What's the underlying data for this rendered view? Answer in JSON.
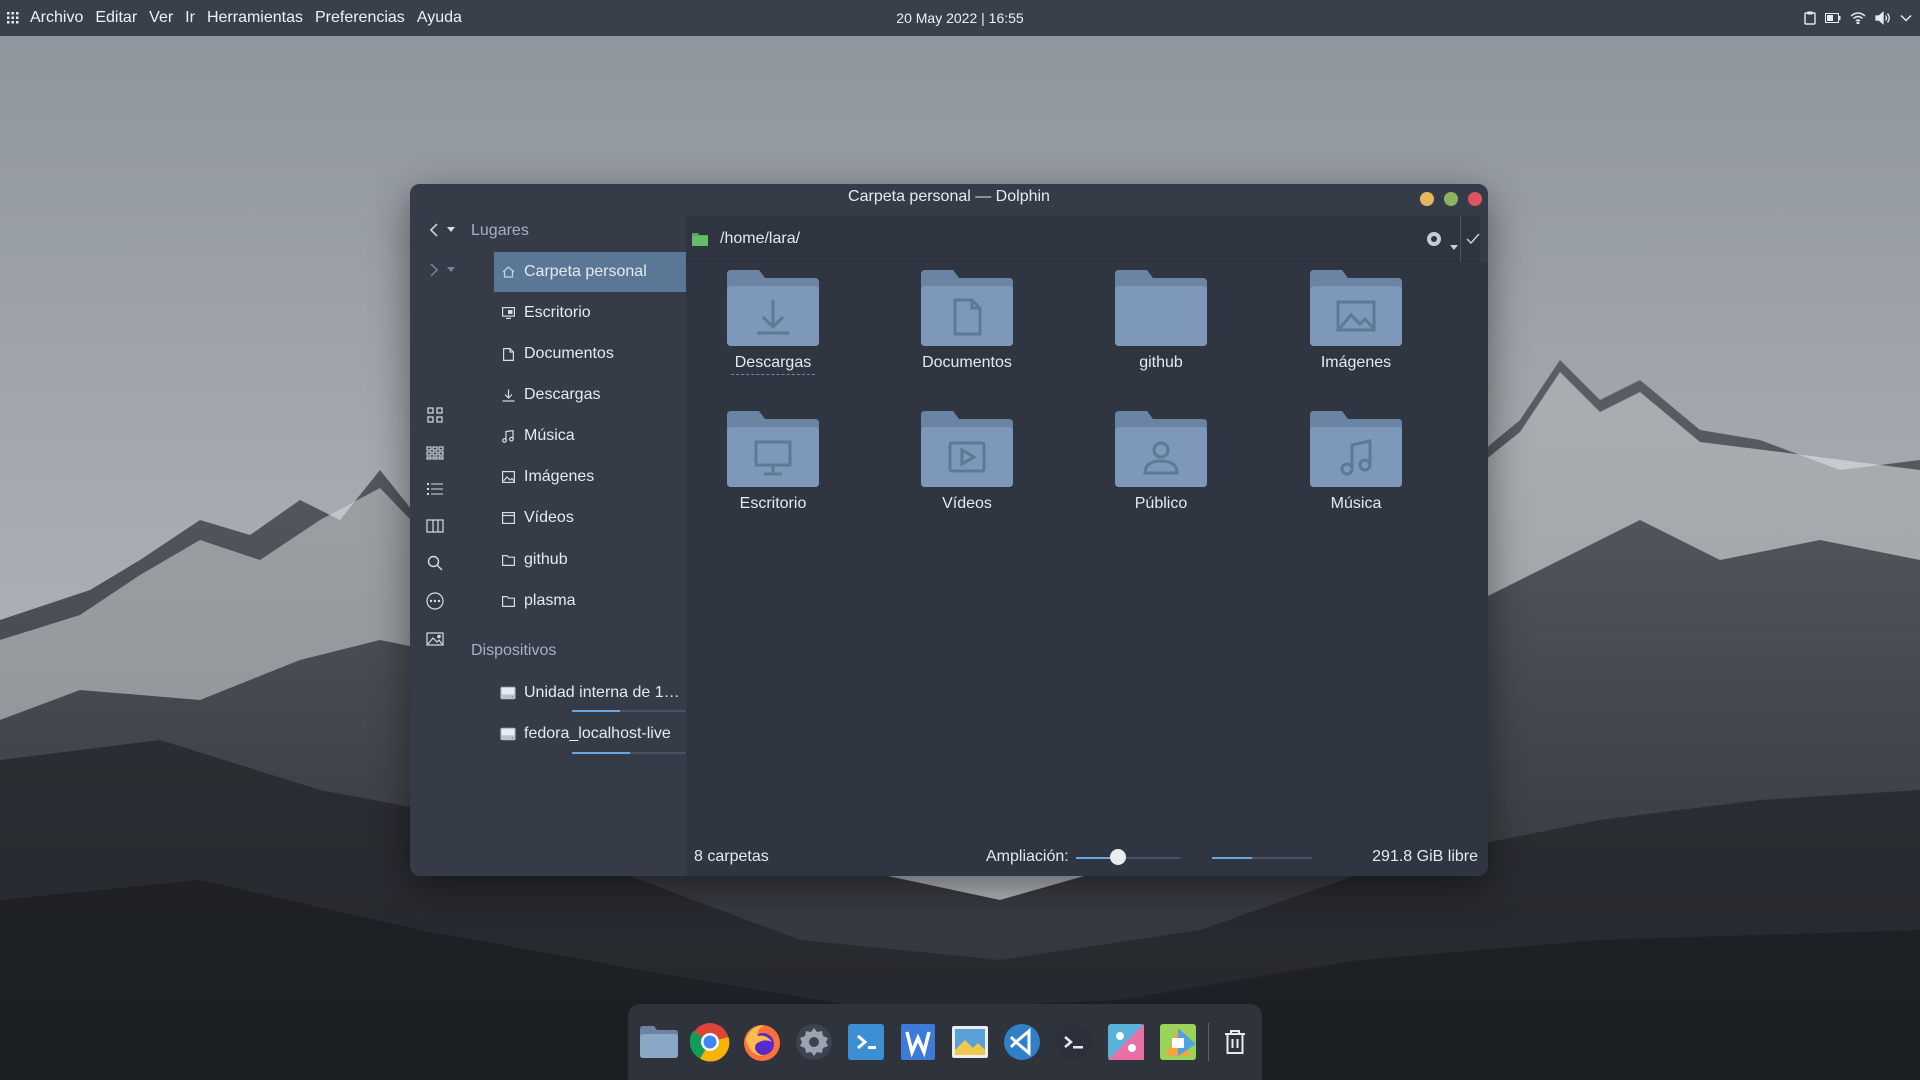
{
  "menubar": {
    "items": [
      "Archivo",
      "Editar",
      "Ver",
      "Ir",
      "Herramientas",
      "Preferencias",
      "Ayuda"
    ],
    "clock": "20 May 2022 | 16:55"
  },
  "tray": {
    "icons": [
      "clipboard-icon",
      "battery-icon",
      "wifi-icon",
      "volume-icon",
      "chevron-down-icon"
    ]
  },
  "window": {
    "title": "Carpeta personal — Dolphin",
    "path": "/home/lara/"
  },
  "sidebar": {
    "places_title": "Lugares",
    "places": [
      {
        "label": "Carpeta personal",
        "icon": "home-icon",
        "active": true
      },
      {
        "label": "Escritorio",
        "icon": "desktop-icon"
      },
      {
        "label": "Documentos",
        "icon": "document-icon"
      },
      {
        "label": "Descargas",
        "icon": "download-icon"
      },
      {
        "label": "Música",
        "icon": "music-icon"
      },
      {
        "label": "Imágenes",
        "icon": "image-icon"
      },
      {
        "label": "Vídeos",
        "icon": "video-icon"
      },
      {
        "label": "github",
        "icon": "folder-icon"
      },
      {
        "label": "plasma",
        "icon": "folder-icon"
      }
    ],
    "devices_title": "Dispositivos",
    "devices": [
      {
        "label": "Unidad interna de 1…",
        "icon": "drive-icon",
        "usage": 0.25
      },
      {
        "label": "fedora_localhost-live",
        "icon": "drive-icon",
        "usage": 0.31
      }
    ]
  },
  "folders": [
    {
      "label": "Descargas",
      "icon": "download-icon"
    },
    {
      "label": "Documentos",
      "icon": "document-icon"
    },
    {
      "label": "github",
      "icon": "folder-icon"
    },
    {
      "label": "Imágenes",
      "icon": "image-icon"
    },
    {
      "label": "Escritorio",
      "icon": "desktop-icon"
    },
    {
      "label": "Vídeos",
      "icon": "video-icon"
    },
    {
      "label": "Público",
      "icon": "user-icon"
    },
    {
      "label": "Música",
      "icon": "music-icon"
    }
  ],
  "status": {
    "count": "8 carpetas",
    "zoom_label": "Ampliación:",
    "zoom_level": 0.4,
    "space_used": 0.4,
    "free": "291.8 GiB libre"
  },
  "dock": {
    "apps": [
      "file-manager-icon",
      "chrome-icon",
      "firefox-icon",
      "settings-icon",
      "kdevelop-icon",
      "writer-icon",
      "image-viewer-icon",
      "vscode-icon",
      "terminal-icon",
      "kolourpaint-icon",
      "kate-icon"
    ],
    "trash": "trash-icon"
  },
  "colors": {
    "accent": "#6aa8e4",
    "selection": "#5a7896",
    "window_bg": "#353b47",
    "folder": "#7d98b8"
  }
}
